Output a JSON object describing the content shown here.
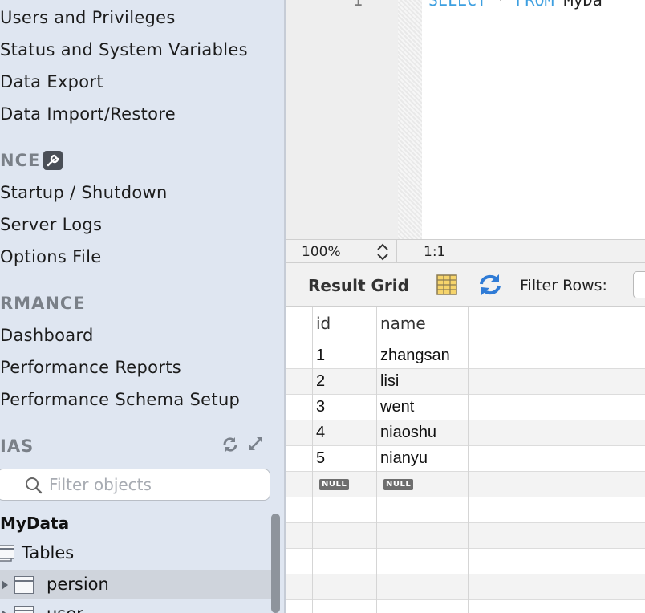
{
  "sidebar": {
    "management_items": [
      "Users and Privileges",
      "Status and System Variables",
      "Data Export",
      "Data Import/Restore"
    ],
    "instance_header": "NCE",
    "instance_items": [
      "Startup / Shutdown",
      "Server Logs",
      "Options File"
    ],
    "performance_header": "RMANCE",
    "performance_items": [
      "Dashboard",
      "Performance Reports",
      "Performance Schema Setup"
    ],
    "schemas_header": "IAS",
    "filter_placeholder": "Filter objects",
    "tree": {
      "database": "MyData",
      "tables_label": "Tables",
      "tables": [
        "persion",
        "user"
      ]
    }
  },
  "editor": {
    "line_number": "1",
    "code": {
      "kw1": "SELECT",
      "mid": " * ",
      "kw2": "FROM",
      "rest": " MyDa"
    }
  },
  "status_bar": {
    "zoom": "100%",
    "cursor": "1:1"
  },
  "result_toolbar": {
    "title": "Result Grid",
    "filter_label": "Filter Rows:"
  },
  "result_grid": {
    "columns": [
      "id",
      "name"
    ],
    "rows": [
      [
        "1",
        "zhangsan"
      ],
      [
        "2",
        "lisi"
      ],
      [
        "3",
        "went"
      ],
      [
        "4",
        "niaoshu"
      ],
      [
        "5",
        "nianyu"
      ]
    ],
    "null_label": "NULL"
  },
  "icons": {
    "wrench": "wrench-icon",
    "refresh": "refresh-icon",
    "expand": "expand-icon",
    "search": "search-icon",
    "grid": "grid-icon",
    "stepper": "stepper-icon"
  },
  "colors": {
    "sidebar_bg": "#dfe6f1",
    "keyword": "#3d9fe0",
    "refresh_accent": "#2f7bd6"
  }
}
